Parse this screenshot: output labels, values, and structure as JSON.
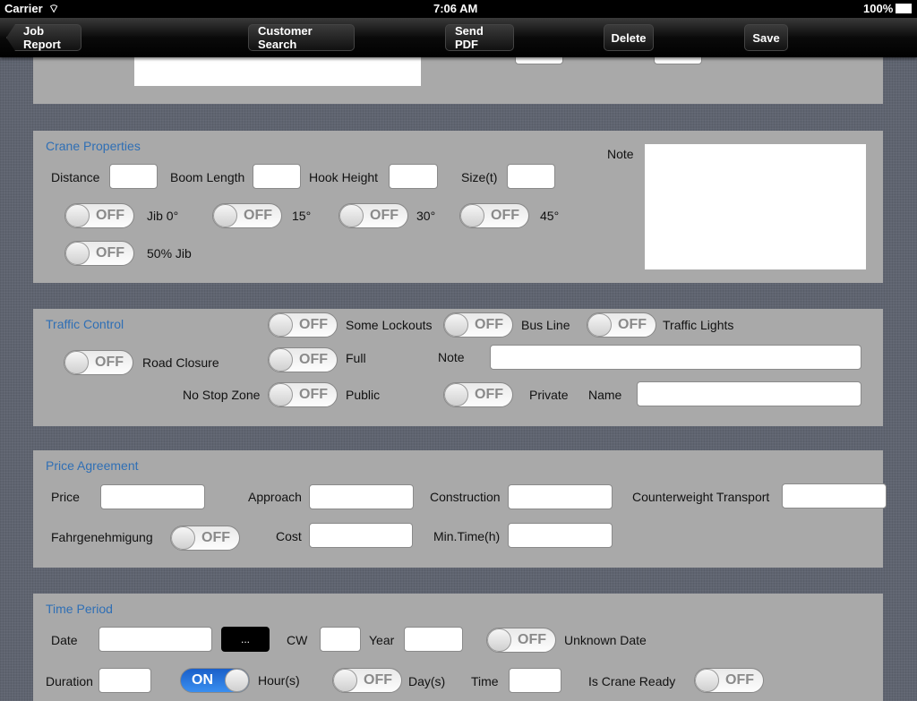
{
  "status": {
    "carrier": "Carrier",
    "time": "7:06 AM",
    "battery": "100%"
  },
  "nav": {
    "back": "Job Report",
    "customer_search": "Customer Search",
    "send_pdf": "Send PDF",
    "delete": "Delete",
    "save": "Save"
  },
  "crane": {
    "title": "Crane Properties",
    "distance": "Distance",
    "boom_length": "Boom Length",
    "hook_height": "Hook Height",
    "size": "Size(t)",
    "jib0": "Jib 0°",
    "j15": "15°",
    "j30": "30°",
    "j45": "45°",
    "jib50": "50% Jib",
    "note": "Note"
  },
  "traffic": {
    "title": "Traffic Control",
    "some_lockouts": "Some Lockouts",
    "bus_line": "Bus Line",
    "traffic_lights": "Traffic Lights",
    "road_closure": "Road Closure",
    "full": "Full",
    "note": "Note",
    "no_stop_zone": "No Stop Zone",
    "public": "Public",
    "private": "Private",
    "name": "Name"
  },
  "price": {
    "title": "Price Agreement",
    "price": "Price",
    "approach": "Approach",
    "construction": "Construction",
    "counterweight": "Counterweight Transport",
    "fahrgenehmigung": "Fahrgenehmigung",
    "cost": "Cost",
    "min_time": "Min.Time(h)"
  },
  "time": {
    "title": "Time Period",
    "date": "Date",
    "picker": "...",
    "cw": "CW",
    "year": "Year",
    "unknown_date": "Unknown Date",
    "duration": "Duration",
    "hours": "Hour(s)",
    "days": "Day(s)",
    "time": "Time",
    "crane_ready": "Is Crane Ready"
  },
  "switch": {
    "off": "OFF",
    "on": "ON"
  },
  "switch_states": {
    "jib0": false,
    "j15": false,
    "j30": false,
    "j45": false,
    "jib50": false,
    "some_lockouts": false,
    "bus_line": false,
    "traffic_lights": false,
    "road_closure": false,
    "full": false,
    "public": false,
    "private": false,
    "fahrgenehmigung": false,
    "unknown_date": false,
    "hours": true,
    "days": false,
    "crane_ready": false
  }
}
